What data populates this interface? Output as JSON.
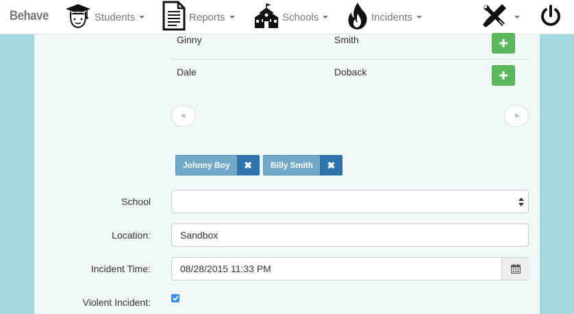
{
  "nav": {
    "brand": "Behave",
    "students": "Students",
    "reports": "Reports",
    "schools": "Schools",
    "incidents": "Incidents",
    "icons": [
      "graduation-cap-icon",
      "document-icon",
      "schoolhouse-icon",
      "fire-icon",
      "tools-icon",
      "power-icon"
    ]
  },
  "students_table": {
    "rows": [
      {
        "first": "Ginny",
        "last": "Smith"
      },
      {
        "first": "Dale",
        "last": "Doback"
      }
    ]
  },
  "pagination": {
    "prev": "«",
    "next": "»"
  },
  "selected_students": [
    {
      "name": "Johnny Boy",
      "remove": "✖"
    },
    {
      "name": "Billy Smith",
      "remove": "✖"
    }
  ],
  "form": {
    "school_label": "School",
    "school_value": "",
    "location_label": "Location:",
    "location_value": "Sandbox",
    "incident_time_label": "Incident Time:",
    "incident_time_value": "08/28/2015 11:33 PM",
    "violent_label": "Violent Incident:",
    "violent_checked": true
  },
  "colors": {
    "background": "#a3d8df",
    "add_button": "#5cb85c",
    "tag": "#72a9c9",
    "tag_remove": "#2f73ad"
  }
}
